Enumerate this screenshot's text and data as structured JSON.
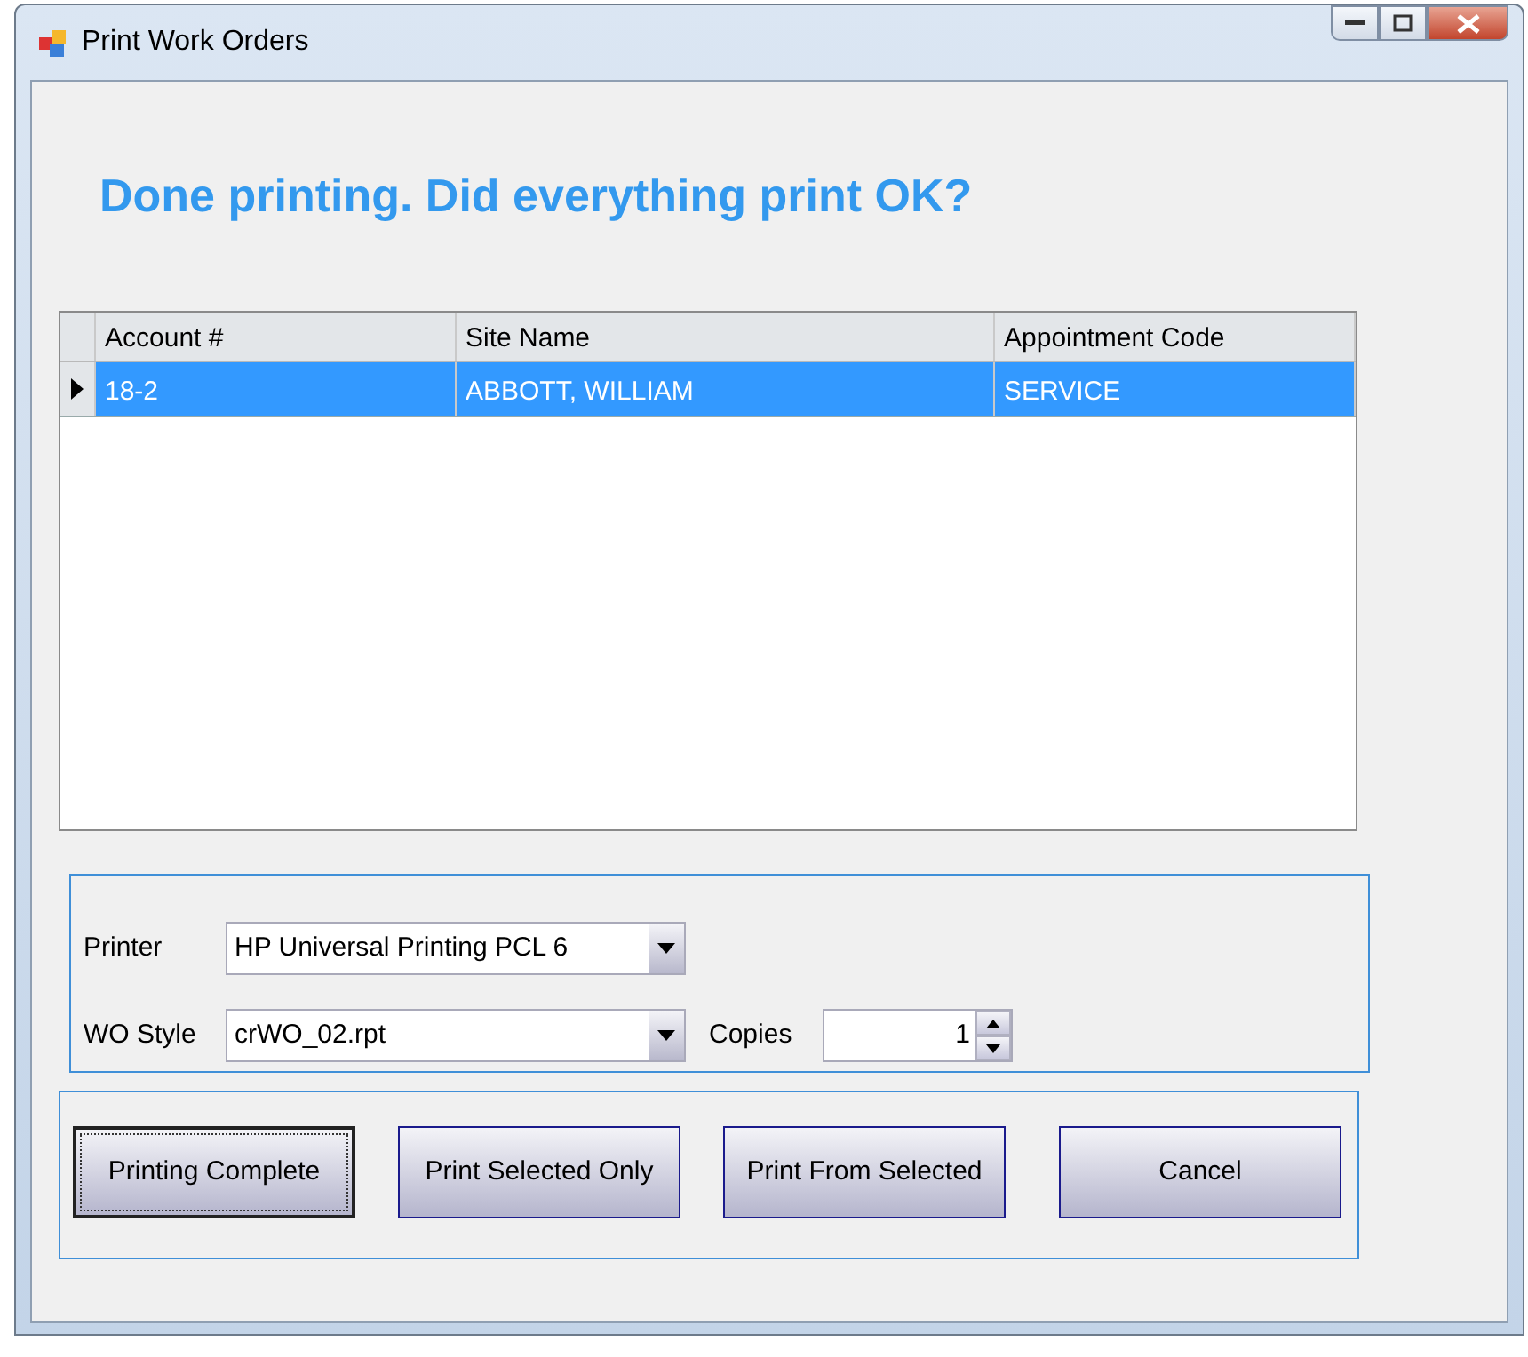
{
  "window": {
    "title": "Print Work Orders"
  },
  "heading": "Done printing. Did everything print OK?",
  "grid": {
    "columns": [
      "Account #",
      "Site Name",
      "Appointment Code"
    ],
    "rows": [
      {
        "cells": [
          "18-2",
          "ABBOTT, WILLIAM",
          "SERVICE"
        ],
        "selected": true
      }
    ]
  },
  "settings": {
    "printer": {
      "label": "Printer",
      "value": "HP Universal Printing PCL 6"
    },
    "style": {
      "label": "WO Style",
      "value": "crWO_02.rpt"
    },
    "copies": {
      "label": "Copies",
      "value": "1"
    }
  },
  "buttons": [
    {
      "label": "Printing Complete",
      "focused": true
    },
    {
      "label": "Print Selected Only",
      "focused": false
    },
    {
      "label": "Print From Selected",
      "focused": false
    },
    {
      "label": "Cancel",
      "focused": false
    }
  ]
}
